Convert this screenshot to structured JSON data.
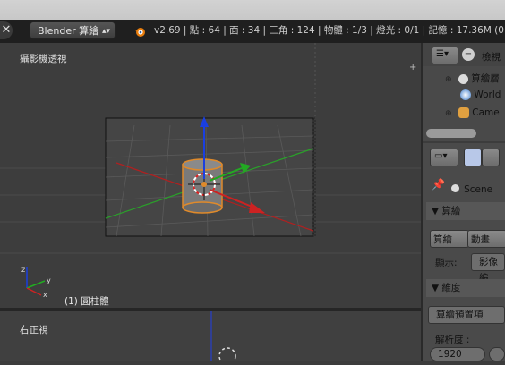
{
  "header": {
    "close_symbol": "✕",
    "engine": "Blender 算繪",
    "engine_arrows": "▴▾",
    "stats": "v2.69 | 點 : 64 | 面 : 34 | 三角 : 124 | 物體 : 1/3 | 燈光 : 0/1 | 記憶 : 17.36M (0"
  },
  "viewport": {
    "title": "攝影機透視",
    "object_label": "(1) 圓柱體",
    "corner_plus": "+"
  },
  "bottom_view": {
    "title": "右正視"
  },
  "outliner": {
    "search_label": "檢視",
    "items": [
      {
        "label": "算繪層",
        "icon": "render-layers-icon"
      },
      {
        "label": "World",
        "icon": "world-icon"
      },
      {
        "label": "Came",
        "icon": "camera-icon"
      }
    ]
  },
  "properties": {
    "scene_label": "Scene",
    "panel_render": "▼ 算繪",
    "render_button": "算繪",
    "animation_button": "動畫",
    "display_label": "顯示:",
    "display_value": "影像編",
    "panel_dimensions": "▼ 維度",
    "presets": "算繪預置項",
    "resolution_label": "解析度 :",
    "res_x": "1920"
  },
  "colors": {
    "accent_object": "#e08a2a",
    "axis_x": "#cc2222",
    "axis_y": "#22aa22",
    "axis_z": "#1a3fe0"
  }
}
